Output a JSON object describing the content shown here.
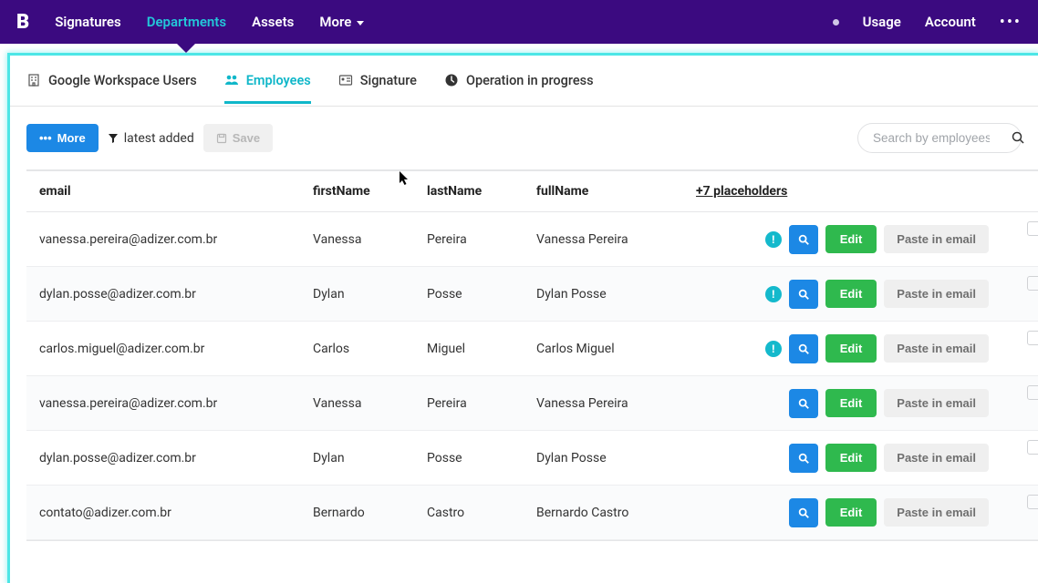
{
  "nav": {
    "logo": "B",
    "items": [
      {
        "label": "Signatures"
      },
      {
        "label": "Departments",
        "active": true
      },
      {
        "label": "Assets"
      },
      {
        "label": "More",
        "dropdown": true
      }
    ],
    "right": [
      {
        "label": "Usage"
      },
      {
        "label": "Account"
      }
    ]
  },
  "tabs": [
    {
      "id": "gw",
      "label": "Google Workspace Users",
      "icon": "building"
    },
    {
      "id": "emp",
      "label": "Employees",
      "icon": "users",
      "active": true
    },
    {
      "id": "sig",
      "label": "Signature",
      "icon": "id-card"
    },
    {
      "id": "op",
      "label": "Operation in progress",
      "icon": "clock"
    }
  ],
  "toolbar": {
    "more_label": "More",
    "filter_label": "latest added",
    "save_label": "Save",
    "search_placeholder": "Search by employees"
  },
  "table": {
    "headers": {
      "email": "email",
      "firstName": "firstName",
      "lastName": "lastName",
      "fullName": "fullName",
      "placeholders": "+7 placeholders"
    },
    "actions": {
      "edit": "Edit",
      "paste": "Paste in email"
    },
    "rows": [
      {
        "email": "vanessa.pereira@adizer.com.br",
        "firstName": "Vanessa",
        "lastName": "Pereira",
        "fullName": "Vanessa Pereira",
        "alert": true
      },
      {
        "email": "dylan.posse@adizer.com.br",
        "firstName": "Dylan",
        "lastName": "Posse",
        "fullName": "Dylan Posse",
        "alert": true
      },
      {
        "email": "carlos.miguel@adizer.com.br",
        "firstName": "Carlos",
        "lastName": "Miguel",
        "fullName": "Carlos Miguel",
        "alert": true
      },
      {
        "email": "vanessa.pereira@adizer.com.br",
        "firstName": "Vanessa",
        "lastName": "Pereira",
        "fullName": "Vanessa Pereira",
        "alert": false
      },
      {
        "email": "dylan.posse@adizer.com.br",
        "firstName": "Dylan",
        "lastName": "Posse",
        "fullName": "Dylan Posse",
        "alert": false
      },
      {
        "email": "contato@adizer.com.br",
        "firstName": "Bernardo",
        "lastName": "Castro",
        "fullName": "Bernardo Castro",
        "alert": false
      }
    ]
  }
}
